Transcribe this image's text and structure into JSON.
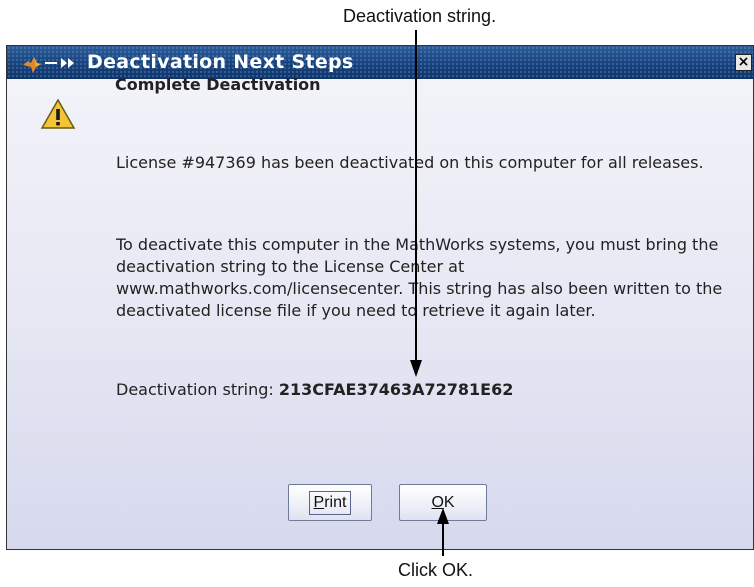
{
  "callouts": {
    "top": "Deactivation string.",
    "bottom": "Click OK."
  },
  "dialog": {
    "title": "Deactivation Next Steps",
    "close_glyph": "×",
    "heading": "Complete Deactivation",
    "paragraph1": "License #947369 has been deactivated on this computer for all releases.",
    "paragraph2": "To deactivate this computer in the MathWorks systems, you must bring the deactivation string to the License Center at www.mathworks.com/licensecenter. This string has also been written to the deactivated license file if you need to retrieve it again later.",
    "deactivation_label": "Deactivation string:",
    "deactivation_string": "213CFAE37463A72781E62",
    "buttons": {
      "print_mnemonic": "P",
      "print_rest": "rint",
      "ok_mnemonic": "O",
      "ok_rest": "K"
    }
  },
  "icons": [
    "java-app-icon",
    "warning-icon",
    "close-icon"
  ],
  "colors": {
    "titlebar": "#18467f",
    "title_text": "#ffffff",
    "warning_fill": "#f2c43a"
  }
}
